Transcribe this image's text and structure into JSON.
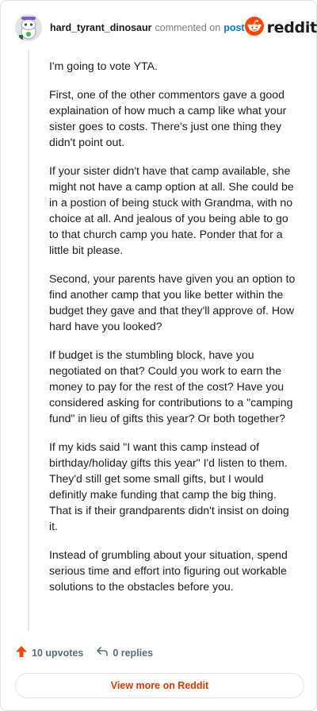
{
  "comment": {
    "username": "hard_tyrant_dinosaur",
    "commented_on": "commented on",
    "post_link": "post",
    "brand": "reddit",
    "paragraphs": [
      "I'm going to vote YTA.",
      "First, one of the other commentors gave a good explaination of how much a camp like what your sister goes to costs. There's just one thing they didn't point out.",
      "If your sister didn't have that camp available, she might not have a camp option at all. She could be in a postion of being stuck with Grandma, with no choice at all. And jealous of you being able to go to that church camp you hate. Ponder that for a little bit please.",
      "Second, your parents have given you an option to find another camp that you like better within the budget they gave and that they'll approve of. How hard have you looked?",
      "If budget is the stumbling block, have you negotiated on that? Could you work to earn the money to pay for the rest of the cost? Have you considered asking for contributions to a \"camping fund\" in lieu of gifts this year? Or both together?",
      "If my kids said \"I want this camp instead of birthday/holiday gifts this year\" I'd listen to them. They'd still get some small gifts, but I would definitly make funding that camp the big thing. That is if their grandparents didn't insist on doing it.",
      "Instead of grumbling about your situation, spend serious time and effort into figuring out workable solutions to the obstacles before you."
    ],
    "upvotes": "10 upvotes",
    "replies": "0 replies",
    "view_more": "View more on Reddit"
  },
  "colors": {
    "upvote": "#ff4500",
    "link": "#0079d3",
    "view_more": "#d93a00",
    "muted": "#7c7c7c"
  },
  "icons": {
    "avatar": "snoo-avatar-icon",
    "brand": "reddit-logo-icon",
    "upvote": "upvote-arrow-icon",
    "reply": "reply-arrow-icon"
  }
}
